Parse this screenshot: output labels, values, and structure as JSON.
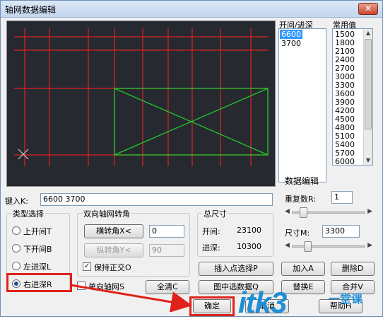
{
  "window": {
    "title": "轴网数据编辑",
    "close_glyph": "✕"
  },
  "bay_list": {
    "header": "开间/进深",
    "items": [
      "6600",
      "3700"
    ],
    "selected": "6600"
  },
  "common_values": {
    "header": "常用值",
    "items": [
      "1500",
      "1800",
      "2100",
      "2400",
      "2700",
      "3000",
      "3300",
      "3600",
      "3900",
      "4200",
      "4500",
      "4800",
      "5100",
      "5400",
      "5700",
      "6000"
    ]
  },
  "input_line": {
    "label": "键入K:",
    "value": "6600  3700"
  },
  "type_group": {
    "title": "类型选择",
    "options": [
      "上开间T",
      "下开间B",
      "左进深L",
      "右进深R"
    ],
    "selected": "右进深R"
  },
  "rotate_group": {
    "title": "双向轴网转角",
    "h_button": "横转角X<",
    "h_value": "0",
    "v_button": "纵转角Y<",
    "v_value": "90",
    "keep_orth_label": "保持正交O",
    "keep_orth_checked": true
  },
  "total_size": {
    "title": "总尺寸",
    "bay_label": "开间:",
    "bay_value": "23100",
    "depth_label": "进深:",
    "depth_value": "10300"
  },
  "data_edit": {
    "title": "数据编辑",
    "repeat_label": "重复数R:",
    "repeat_value": "1",
    "repeat_slider": 0.12,
    "size_label": "尺寸M:",
    "size_value": "3300",
    "size_slider": 0.18
  },
  "buttons": {
    "insert_point": "插入点选择P",
    "add": "加入A",
    "delete": "删除D",
    "single_axis_label": "单向轴网S",
    "single_axis_checked": false,
    "clear_all": "全清C",
    "pick_in_drawing": "图中选数据Q",
    "replace": "替换E",
    "merge": "合并V",
    "ok": "确定",
    "cancel": "取消",
    "help": "帮助H"
  },
  "watermark": {
    "text": "itk3",
    "subtext": "一堂课"
  },
  "colors": {
    "canvas_bg": "#262a30",
    "grid_red": "#e02020",
    "rect_green": "#22c92a",
    "highlight_red": "#e0211b",
    "selected_blue": "#3399ff"
  }
}
